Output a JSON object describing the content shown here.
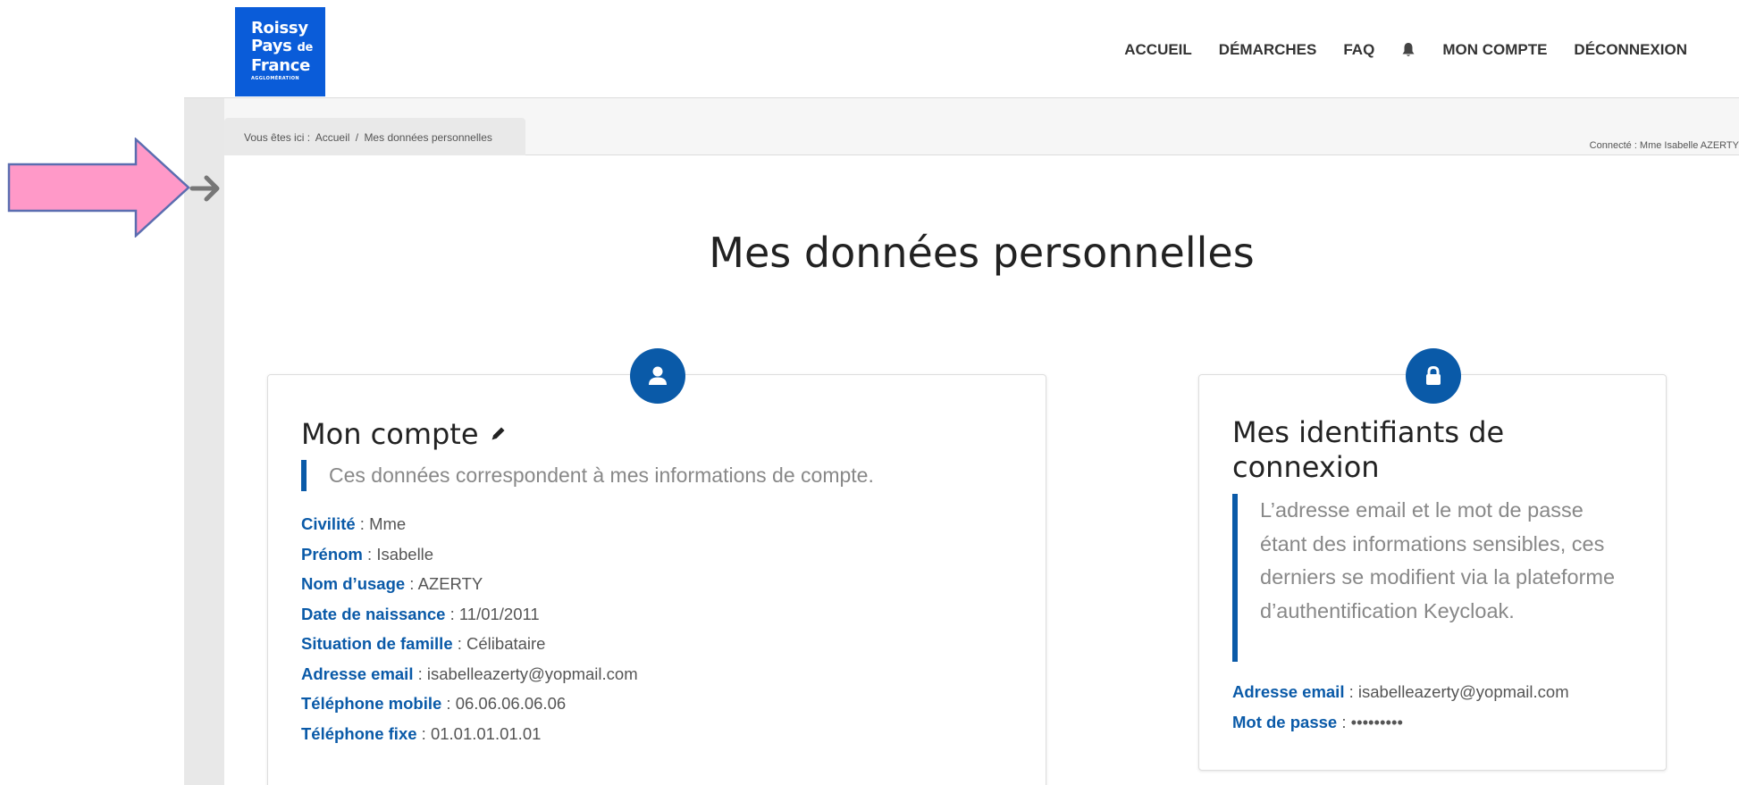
{
  "logo": {
    "line1": "Roissy",
    "line2": "Pays",
    "line2_small": "de",
    "line3": "France",
    "line4": "AGGLOMÉRATION"
  },
  "nav": {
    "accueil": "ACCUEIL",
    "demarches": "DÉMARCHES",
    "faq": "FAQ",
    "bell_icon": "bell-icon",
    "mon_compte": "MON COMPTE",
    "deconnexion": "DÉCONNEXION"
  },
  "breadcrumb": {
    "prefix": "Vous êtes ici :",
    "home": "Accueil",
    "sep": "/",
    "current": "Mes données personnelles"
  },
  "connected": "Connecté : Mme Isabelle AZERTY",
  "page_title": "Mes données personnelles",
  "account": {
    "icon": "user-icon",
    "title": "Mon compte",
    "edit_icon": "pencil-icon",
    "note": "Ces données correspondent à mes informations de compte.",
    "fields": [
      {
        "label": "Civilité",
        "value": "Mme"
      },
      {
        "label": "Prénom",
        "value": "Isabelle"
      },
      {
        "label": "Nom d’usage",
        "value": "AZERTY"
      },
      {
        "label": "Date de naissance",
        "value": "11/01/2011"
      },
      {
        "label": "Situation de famille",
        "value": "Célibataire"
      },
      {
        "label": "Adresse email",
        "value": "isabelleazerty@yopmail.com"
      },
      {
        "label": "Téléphone mobile",
        "value": "06.06.06.06.06"
      },
      {
        "label": "Téléphone fixe",
        "value": "01.01.01.01.01"
      }
    ]
  },
  "credentials": {
    "icon": "lock-icon",
    "title": "Mes identifiants de connexion",
    "note": "L’adresse email et le mot de passe étant des informations sensibles, ces derniers se modifient via la plateforme d’authentification Keycloak.",
    "fields": [
      {
        "label": "Adresse email",
        "value": "isabelleazerty@yopmail.com"
      },
      {
        "label": "Mot de passe",
        "value": "•••••••••"
      }
    ]
  },
  "sidebar": {
    "toggle_icon": "arrow-right-icon"
  },
  "annotation": {
    "icon": "pink-arrow-icon"
  },
  "colors": {
    "brand": "#0a5cd9",
    "accent": "#0a5aa8",
    "annotation": "#ff99c8"
  }
}
